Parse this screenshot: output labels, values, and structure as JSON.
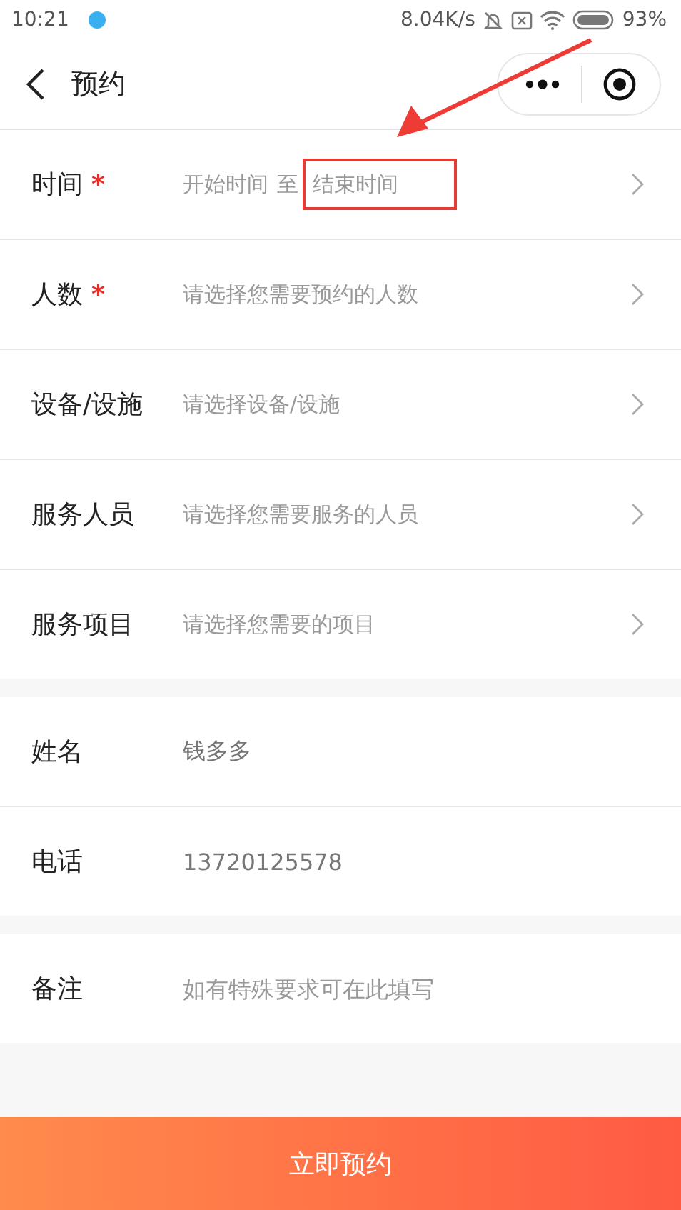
{
  "status_bar": {
    "time": "10:21",
    "speed": "8.04K/s",
    "battery": "93%"
  },
  "nav": {
    "title": "预约"
  },
  "groups": [
    {
      "rows": [
        {
          "kind": "range",
          "label": "时间",
          "required_mark": "*",
          "start": "开始时间",
          "separator": "至",
          "end": "结束时间"
        },
        {
          "kind": "picker",
          "label": "人数",
          "required_mark": "*",
          "placeholder": "请选择您需要预约的人数"
        },
        {
          "kind": "picker",
          "label": "设备/设施",
          "placeholder": "请选择设备/设施"
        },
        {
          "kind": "picker",
          "label": "服务人员",
          "placeholder": "请选择您需要服务的人员"
        },
        {
          "kind": "picker",
          "label": "服务项目",
          "placeholder": "请选择您需要的项目"
        }
      ]
    },
    {
      "rows": [
        {
          "kind": "input",
          "label": "姓名",
          "value": "钱多多"
        },
        {
          "kind": "input",
          "label": "电话",
          "value": "13720125578"
        }
      ]
    },
    {
      "rows": [
        {
          "kind": "input",
          "label": "备注",
          "placeholder": "如有特殊要求可在此填写"
        }
      ]
    }
  ],
  "submit": {
    "label": "立即预约"
  }
}
